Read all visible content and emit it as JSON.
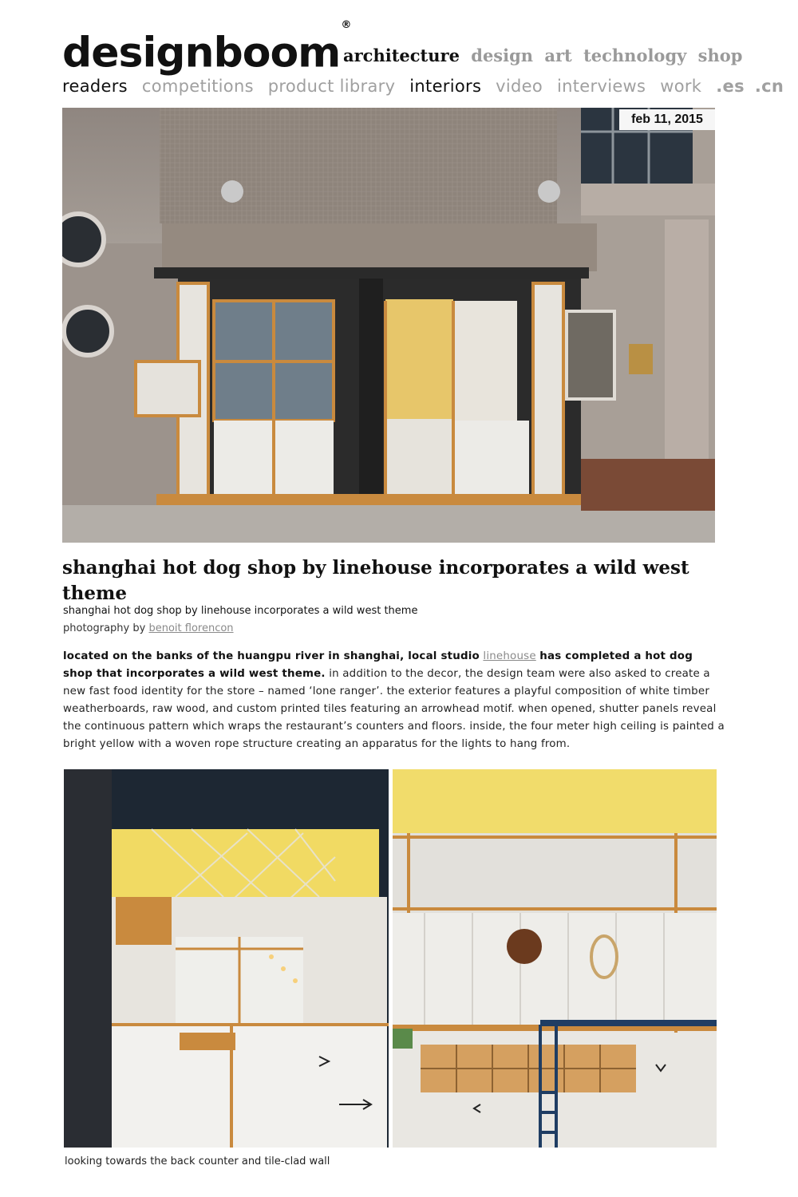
{
  "logo": {
    "text": "designboom",
    "mark": "®"
  },
  "nav_primary": [
    "architecture",
    "design",
    "art",
    "technology",
    "shop"
  ],
  "nav_primary_active": "architecture",
  "nav_secondary": [
    "readers",
    "competitions",
    "product library",
    "interiors",
    "video",
    "interviews",
    "work"
  ],
  "nav_lang": [
    ".es",
    ".cn"
  ],
  "date": "feb 11, 2015",
  "headline": "shanghai hot dog shop by linehouse incorporates a wild west theme",
  "article": {
    "subtitle": "shanghai hot dog shop by linehouse incorporates a wild west theme",
    "credit_prefix": "photography by",
    "credit_link": "benoit florencon",
    "body_bold_1": "located on the banks of the huangpu river in shanghai, local studio",
    "body_link": "linehouse",
    "body_bold_2": "has completed a hot dog shop that incorporates a wild west theme.",
    "body_rest": "in addition to the decor, the design team were also asked to create a new fast food identity for the store – named ‘lone ranger’. the exterior features a playful composition of white timber weatherboards, raw wood, and custom printed tiles featuring an arrowhead motif. when opened, shutter panels reveal the continuous pattern which wraps the restaurant’s counters and floors. inside, the four meter high ceiling is painted a bright yellow with a woven rope structure creating an apparatus for the lights to hang from."
  },
  "caption": "looking towards the back counter and tile-clad wall",
  "colors": {
    "text": "#111111",
    "nav_inactive": "#9a9a9a",
    "link": "#8a8a8a",
    "ceiling_yellow": "#f3df6a",
    "wood": "#c98a3e"
  }
}
